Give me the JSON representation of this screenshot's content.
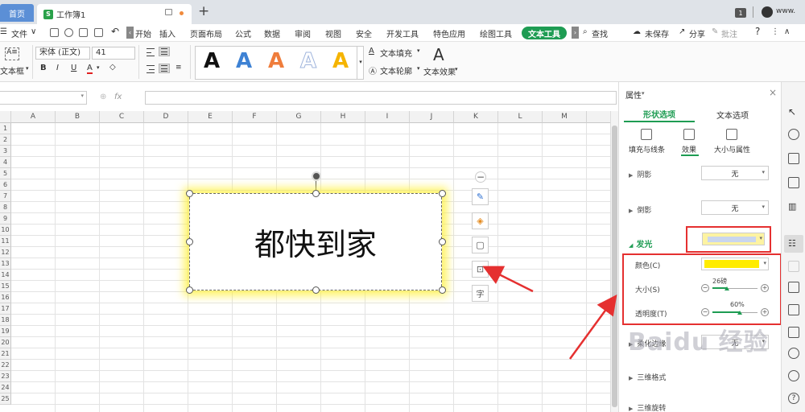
{
  "tabbar": {
    "home": "首页",
    "doc_icon": "S",
    "doc_name": "工作簿1",
    "add": "+",
    "badge": "1",
    "user": "www."
  },
  "menubar": {
    "file": "文件",
    "collapse_left": "‹",
    "items": [
      "开始",
      "插入",
      "页面布局",
      "公式",
      "数据",
      "审阅",
      "视图",
      "安全",
      "开发工具",
      "特色应用",
      "绘图工具"
    ],
    "active": "文本工具",
    "collapse_right": "›",
    "search": "查找",
    "unsaved": "未保存",
    "share": "分享",
    "comment": "批注",
    "help": "?"
  },
  "ribbon": {
    "textbox_label": "文本框",
    "font_name": "宋体 (正文)",
    "font_size": "41",
    "bold": "B",
    "italic": "I",
    "underline": "U",
    "font_color": "A",
    "style_letters": [
      "A",
      "A",
      "A",
      "A",
      "A"
    ],
    "style_colors": [
      "#111111",
      "#3e82d4",
      "#ef7d3c",
      "#9fb4dc",
      "#f5b400"
    ],
    "text_fill": "文本填充",
    "text_outline": "文本轮廓",
    "text_effect": "文本效果",
    "effect_icon": "A"
  },
  "formula": {
    "fx": "fx"
  },
  "grid": {
    "columns": [
      "A",
      "B",
      "C",
      "D",
      "E",
      "F",
      "G",
      "H",
      "I",
      "J",
      "K",
      "L",
      "M"
    ],
    "rows": [
      "1",
      "2",
      "3",
      "4",
      "5",
      "6",
      "7",
      "8",
      "9",
      "10",
      "11",
      "12",
      "13",
      "14",
      "15",
      "16",
      "17",
      "18",
      "19",
      "20",
      "21",
      "22",
      "23",
      "24",
      "25"
    ]
  },
  "textbox": {
    "content": "都快到家"
  },
  "float_tools": {
    "collapse": "−",
    "char": "字"
  },
  "panel": {
    "title": "属性",
    "close": "×",
    "tab_shape": "形状选项",
    "tab_text": "文本选项",
    "sub_fill": "填充与线条",
    "sub_effect": "效果",
    "sub_size": "大小与属性",
    "shadow": "阴影",
    "shadow_value": "无",
    "reflection": "倒影",
    "reflection_value": "无",
    "glow": "发光",
    "glow_color_label": "颜色(C)",
    "glow_color": "#ffec00",
    "glow_size_label": "大小(S)",
    "glow_size": "26磅",
    "glow_size_fraction": 0.32,
    "glow_transparency_label": "透明度(T)",
    "glow_transparency": "60%",
    "glow_transparency_fraction": 0.6,
    "soft_edges": "柔化边缘",
    "soft_edges_value": "无",
    "three_d_format": "三维格式",
    "three_d_rotation": "三维旋转"
  },
  "watermark": "Baidu 经验",
  "colors": {
    "accent_green": "#1e9c53",
    "highlight_red": "#e53030",
    "glow_yellow": "#ffec00"
  }
}
